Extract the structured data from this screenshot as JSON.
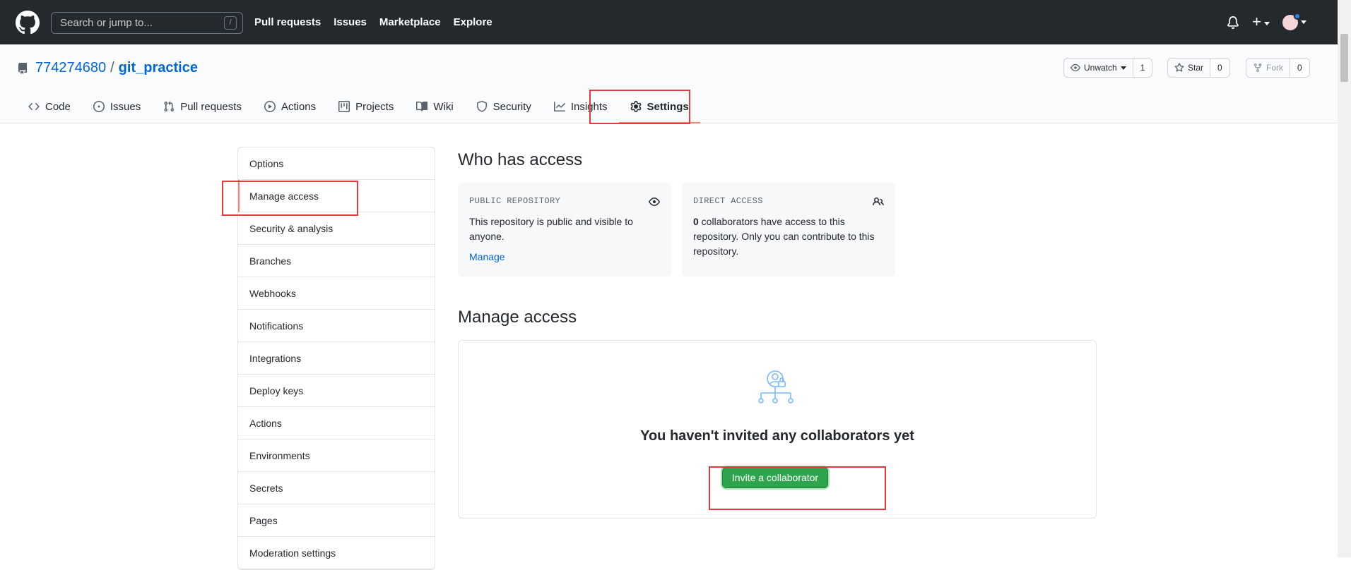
{
  "header": {
    "search_placeholder": "Search or jump to...",
    "search_shortcut": "/",
    "nav": [
      "Pull requests",
      "Issues",
      "Marketplace",
      "Explore"
    ],
    "plus_label": "+"
  },
  "repo": {
    "owner": "774274680",
    "separator": "/",
    "name": "git_practice",
    "watch_label": "Unwatch",
    "watch_count": "1",
    "star_label": "Star",
    "star_count": "0",
    "fork_label": "Fork",
    "fork_count": "0"
  },
  "tabs": [
    {
      "label": "Code",
      "icon": "code-icon"
    },
    {
      "label": "Issues",
      "icon": "issue-icon"
    },
    {
      "label": "Pull requests",
      "icon": "pull-request-icon"
    },
    {
      "label": "Actions",
      "icon": "play-icon"
    },
    {
      "label": "Projects",
      "icon": "project-icon"
    },
    {
      "label": "Wiki",
      "icon": "book-icon"
    },
    {
      "label": "Security",
      "icon": "shield-icon"
    },
    {
      "label": "Insights",
      "icon": "graph-icon"
    },
    {
      "label": "Settings",
      "icon": "gear-icon",
      "selected": true
    }
  ],
  "sidebar": {
    "items": [
      {
        "label": "Options"
      },
      {
        "label": "Manage access",
        "selected": true
      },
      {
        "label": "Security & analysis"
      },
      {
        "label": "Branches"
      },
      {
        "label": "Webhooks"
      },
      {
        "label": "Notifications"
      },
      {
        "label": "Integrations"
      },
      {
        "label": "Deploy keys"
      },
      {
        "label": "Actions"
      },
      {
        "label": "Environments"
      },
      {
        "label": "Secrets"
      },
      {
        "label": "Pages"
      },
      {
        "label": "Moderation settings"
      }
    ]
  },
  "main": {
    "who_title": "Who has access",
    "public_card": {
      "heading": "PUBLIC REPOSITORY",
      "text": "This repository is public and visible to anyone.",
      "link": "Manage"
    },
    "direct_card": {
      "heading": "DIRECT ACCESS",
      "count": "0",
      "text": " collaborators have access to this repository. Only you can contribute to this repository."
    },
    "manage_title": "Manage access",
    "empty_title": "You haven't invited any collaborators yet",
    "invite_button": "Invite a collaborator"
  },
  "colors": {
    "header_bg": "#24292e",
    "link": "#0366d6",
    "primary_button": "#2ea44f",
    "selected_underline": "#f9826c",
    "annotation_red": "#e5393c"
  }
}
